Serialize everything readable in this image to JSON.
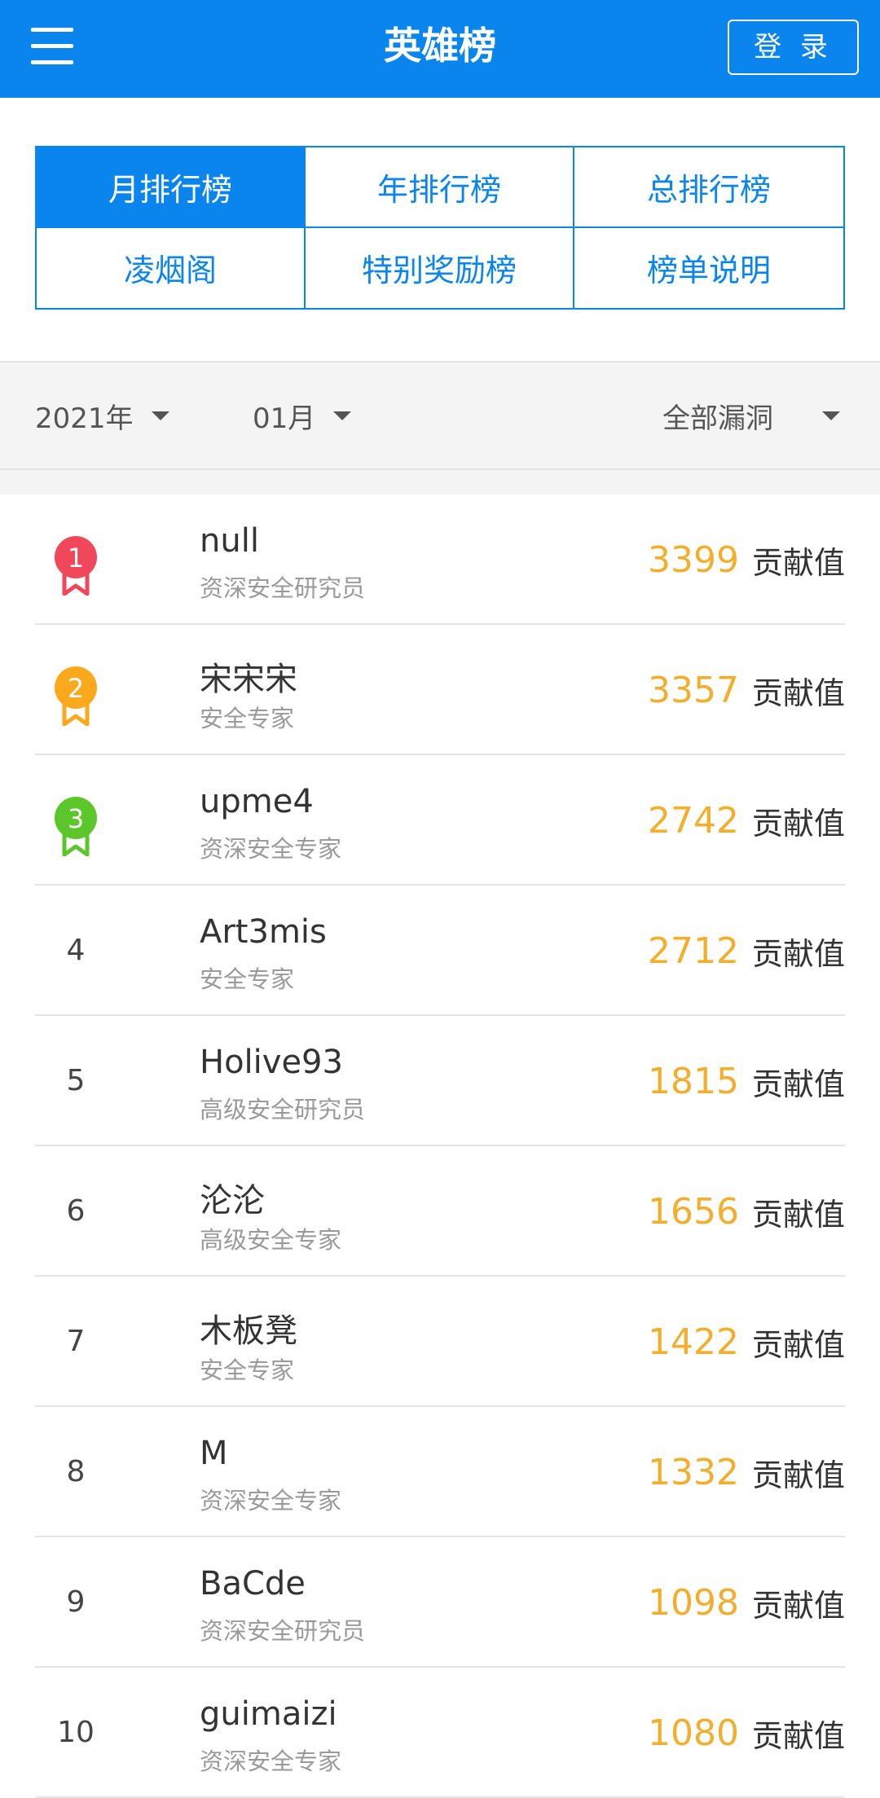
{
  "header": {
    "title": "英雄榜",
    "login_label": "登 录"
  },
  "tabs": [
    {
      "label": "月排行榜",
      "active": true
    },
    {
      "label": "年排行榜",
      "active": false
    },
    {
      "label": "总排行榜",
      "active": false
    },
    {
      "label": "凌烟阁",
      "active": false
    },
    {
      "label": "特别奖励榜",
      "active": false
    },
    {
      "label": "榜单说明",
      "active": false
    }
  ],
  "filters": {
    "year": "2021年",
    "month": "01月",
    "type": "全部漏洞"
  },
  "score_label": "贡献值",
  "colors": {
    "primary": "#0a85ee",
    "score": "#f2ae2c",
    "medal_1": "#f0475b",
    "medal_2": "#f9a91b",
    "medal_3": "#5cc72a"
  },
  "rankings": [
    {
      "rank": "1",
      "name": "null",
      "title": "资深安全研究员",
      "score": "3399"
    },
    {
      "rank": "2",
      "name": "宋宋宋",
      "title": "安全专家",
      "score": "3357"
    },
    {
      "rank": "3",
      "name": "upme4",
      "title": "资深安全专家",
      "score": "2742"
    },
    {
      "rank": "4",
      "name": "Art3mis",
      "title": "安全专家",
      "score": "2712"
    },
    {
      "rank": "5",
      "name": "Holive93",
      "title": "高级安全研究员",
      "score": "1815"
    },
    {
      "rank": "6",
      "name": "沦沦",
      "title": "高级安全专家",
      "score": "1656"
    },
    {
      "rank": "7",
      "name": "木板凳",
      "title": "安全专家",
      "score": "1422"
    },
    {
      "rank": "8",
      "name": "M",
      "title": "资深安全专家",
      "score": "1332"
    },
    {
      "rank": "9",
      "name": "BaCde",
      "title": "资深安全研究员",
      "score": "1098"
    },
    {
      "rank": "10",
      "name": "guimaizi",
      "title": "资深安全专家",
      "score": "1080"
    }
  ]
}
